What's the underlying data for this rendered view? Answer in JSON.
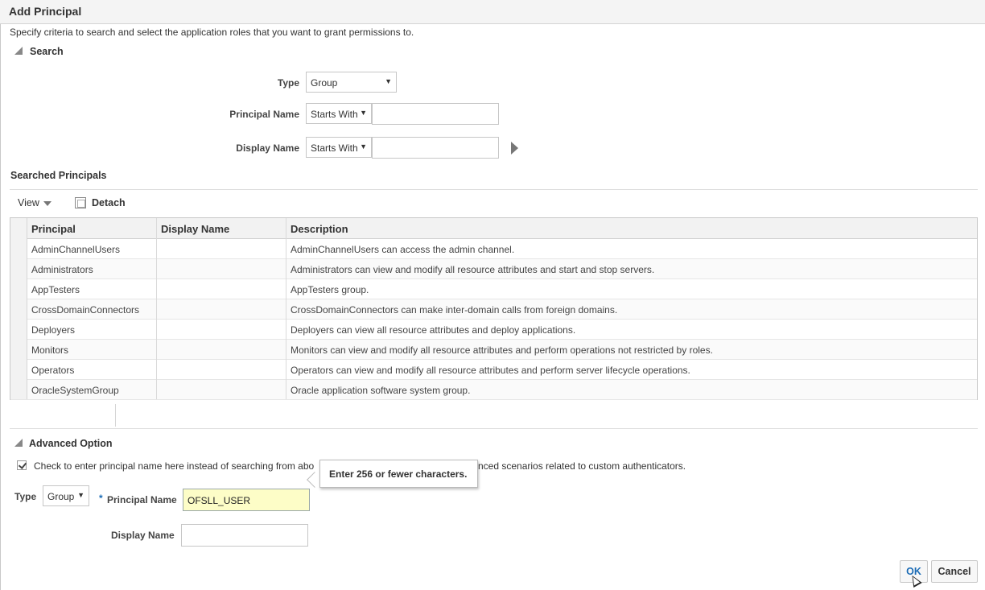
{
  "dialog": {
    "title": "Add Principal",
    "instructions": "Specify criteria to search and select the application roles that you want to grant permissions to."
  },
  "search": {
    "header": "Search",
    "type_label": "Type",
    "type_value": "Group",
    "principal_name_label": "Principal Name",
    "principal_name_operator": "Starts With",
    "principal_name_value": "",
    "display_name_label": "Display Name",
    "display_name_operator": "Starts With",
    "display_name_value": ""
  },
  "results": {
    "header": "Searched Principals",
    "view_label": "View",
    "detach_label": "Detach",
    "columns": [
      "Principal",
      "Display Name",
      "Description"
    ],
    "rows": [
      {
        "principal": "AdminChannelUsers",
        "display_name": "",
        "description": "AdminChannelUsers can access the admin channel."
      },
      {
        "principal": "Administrators",
        "display_name": "",
        "description": "Administrators can view and modify all resource attributes and start and stop servers."
      },
      {
        "principal": "AppTesters",
        "display_name": "",
        "description": "AppTesters group."
      },
      {
        "principal": "CrossDomainConnectors",
        "display_name": "",
        "description": "CrossDomainConnectors can make inter-domain calls from foreign domains."
      },
      {
        "principal": "Deployers",
        "display_name": "",
        "description": "Deployers can view all resource attributes and deploy applications."
      },
      {
        "principal": "Monitors",
        "display_name": "",
        "description": "Monitors can view and modify all resource attributes and perform operations not restricted by roles."
      },
      {
        "principal": "Operators",
        "display_name": "",
        "description": "Operators can view and modify all resource attributes and perform server lifecycle operations."
      },
      {
        "principal": "OracleSystemGroup",
        "display_name": "",
        "description": "Oracle application software system group."
      }
    ]
  },
  "advanced": {
    "header": "Advanced Option",
    "checkbox_checked": true,
    "checkbox_text": "Check to enter principal name here instead of searching from abo",
    "checkbox_text_tail": "nced scenarios related to custom authenticators.",
    "type_label": "Type",
    "type_value": "Group",
    "required_marker": "*",
    "principal_name_label": "Principal Name",
    "principal_name_value": "OFSLL_USER",
    "display_name_label": "Display Name",
    "display_name_value": "",
    "tooltip": "Enter 256 or fewer characters."
  },
  "buttons": {
    "ok": "OK",
    "cancel": "Cancel"
  },
  "colors": {
    "ok_text": "#1a6bb5",
    "input_highlight": "#fdfdc7"
  }
}
